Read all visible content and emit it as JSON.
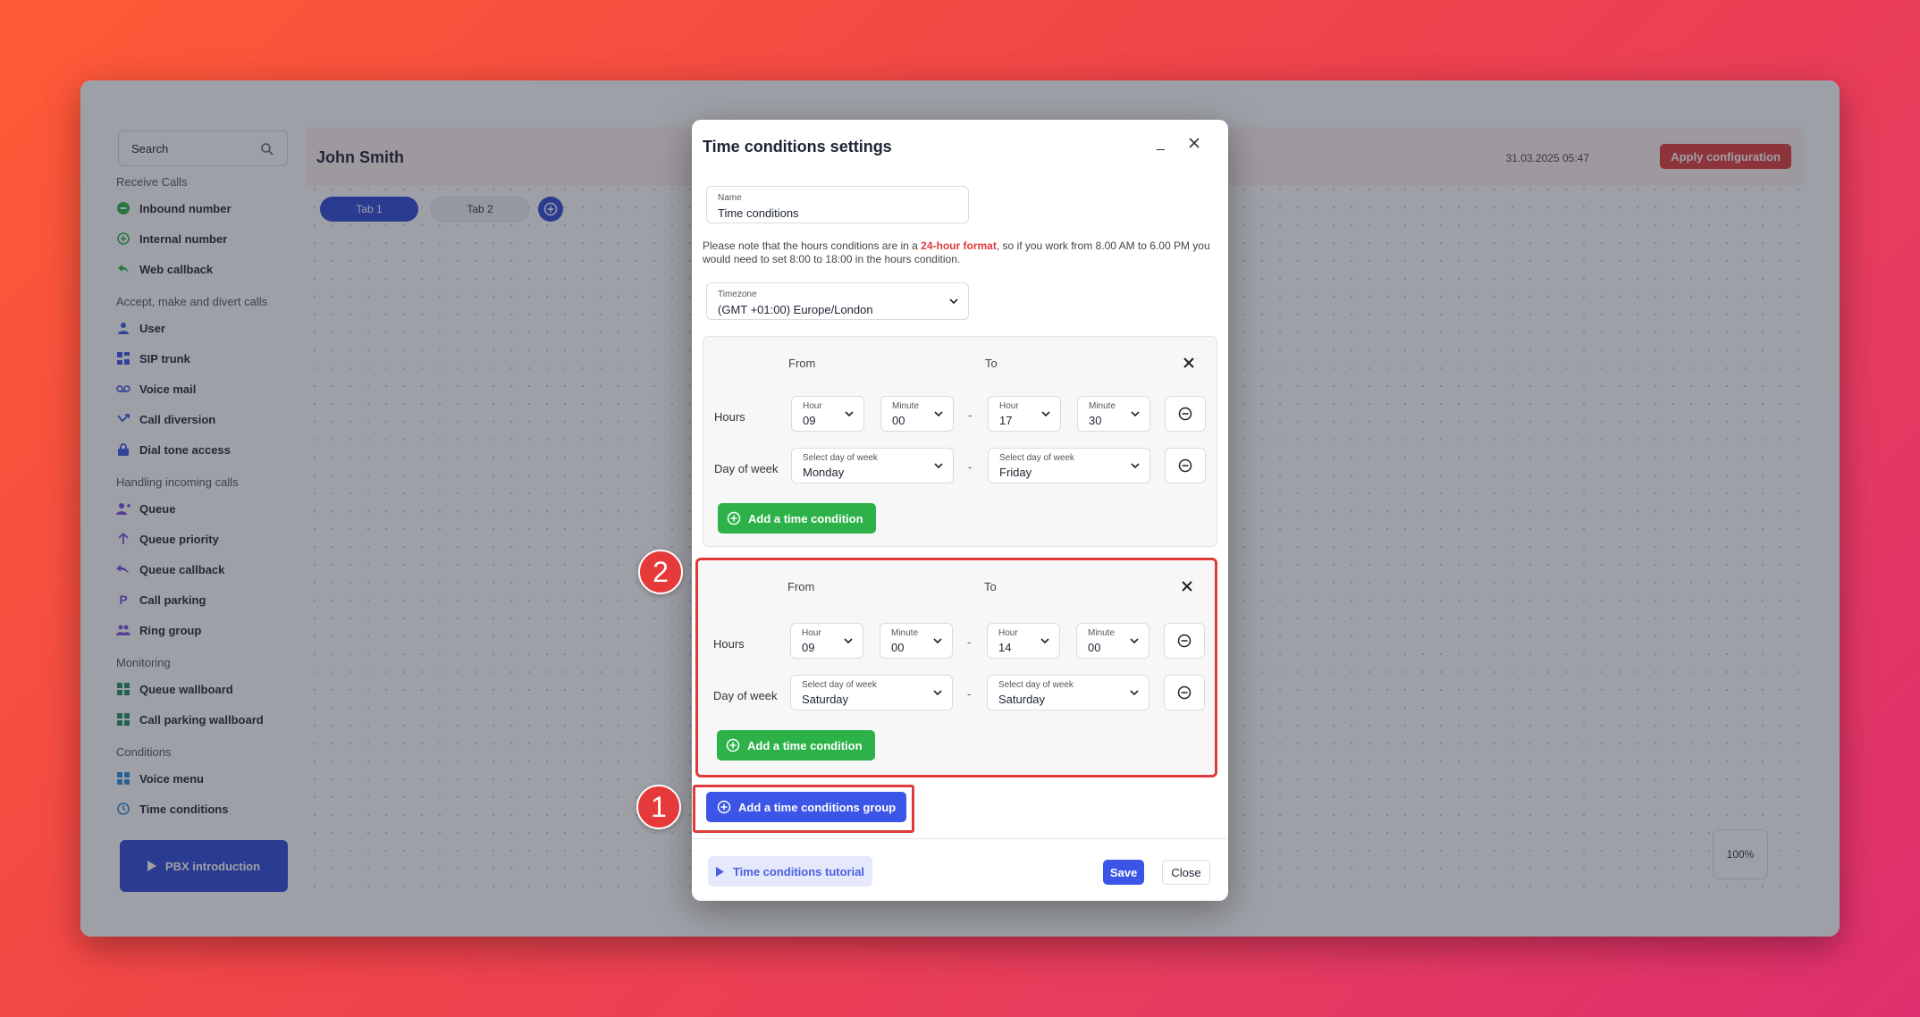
{
  "sidebar": {
    "search_placeholder": "Search",
    "sections": [
      {
        "title": "Receive Calls",
        "items": [
          {
            "label": "Inbound number",
            "icon": "inbound-icon"
          },
          {
            "label": "Internal number",
            "icon": "internal-icon"
          },
          {
            "label": "Web callback",
            "icon": "web-callback-icon"
          }
        ]
      },
      {
        "title": "Accept, make and divert calls",
        "items": [
          {
            "label": "User",
            "icon": "user-icon"
          },
          {
            "label": "SIP trunk",
            "icon": "sip-trunk-icon"
          },
          {
            "label": "Voice mail",
            "icon": "voicemail-icon"
          },
          {
            "label": "Call diversion",
            "icon": "call-diversion-icon"
          },
          {
            "label": "Dial tone access",
            "icon": "lock-icon"
          }
        ]
      },
      {
        "title": "Handling incoming calls",
        "items": [
          {
            "label": "Queue",
            "icon": "queue-icon"
          },
          {
            "label": "Queue priority",
            "icon": "arrow-up-icon"
          },
          {
            "label": "Queue callback",
            "icon": "queue-callback-icon"
          },
          {
            "label": "Call parking",
            "icon": "parking-icon"
          },
          {
            "label": "Ring group",
            "icon": "ring-group-icon"
          }
        ]
      },
      {
        "title": "Monitoring",
        "items": [
          {
            "label": "Queue wallboard",
            "icon": "wallboard-icon"
          },
          {
            "label": "Call parking wallboard",
            "icon": "wallboard-icon"
          }
        ]
      },
      {
        "title": "Conditions",
        "items": [
          {
            "label": "Voice menu",
            "icon": "voice-menu-icon"
          },
          {
            "label": "Time conditions",
            "icon": "clock-icon"
          }
        ]
      }
    ],
    "pbx_button": "PBX introduction"
  },
  "header": {
    "user_name": "John Smith",
    "datetime": "31.03.2025 05:47",
    "apply_button": "Apply configuration"
  },
  "tabs": [
    "Tab 1",
    "Tab 2"
  ],
  "zoom": "100%",
  "modal": {
    "title": "Time conditions settings",
    "minimize": "_",
    "name_label": "Name",
    "name_value": "Time conditions",
    "note_prefix": "Please note that the hours conditions are in a ",
    "note_highlight": "24-hour format",
    "note_suffix": ", so if you work from 8.00 AM to 6.00 PM you would need to set 8:00 to 18:00 in the hours condition.",
    "timezone_label": "Timezone",
    "timezone_value": "(GMT +01:00) Europe/London",
    "groups": [
      {
        "from_label": "From",
        "to_label": "To",
        "hours_label": "Hours",
        "from_hour": "09",
        "from_minute": "00",
        "to_hour": "17",
        "to_minute": "30",
        "day_label": "Day of week",
        "from_day": "Monday",
        "to_day": "Friday",
        "add_button": "Add a time condition"
      },
      {
        "from_label": "From",
        "to_label": "To",
        "hours_label": "Hours",
        "from_hour": "09",
        "from_minute": "00",
        "to_hour": "14",
        "to_minute": "00",
        "day_label": "Day of week",
        "from_day": "Saturday",
        "to_day": "Saturday",
        "add_button": "Add a time condition"
      }
    ],
    "hour_label": "Hour",
    "minute_label": "Minute",
    "day_select_label": "Select day of week",
    "dash": "-",
    "add_group_button": "Add a time conditions group",
    "tutorial_button": "Time conditions tutorial",
    "save_button": "Save",
    "close_button": "Close"
  },
  "annotations": {
    "step1": "1",
    "step2": "2"
  },
  "colors": {
    "primary": "#3b55e6",
    "success": "#2db24a",
    "danger": "#e03b3b"
  }
}
